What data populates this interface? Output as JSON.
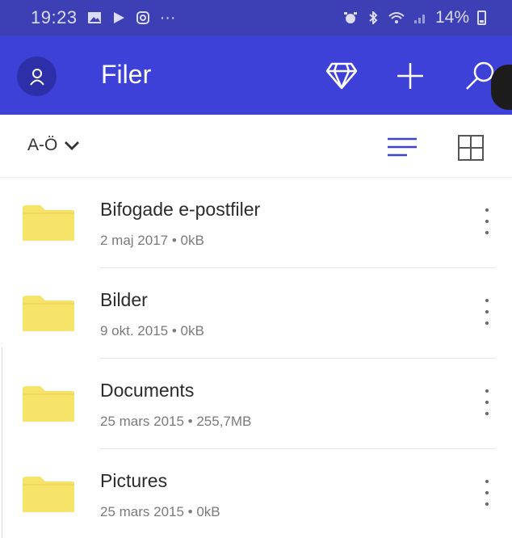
{
  "status_bar": {
    "time": "19:23",
    "battery": "14%",
    "dots": "···"
  },
  "app_bar": {
    "title": "Filer",
    "icons": [
      "avatar-icon",
      "diamond-icon",
      "plus-icon",
      "search-icon"
    ]
  },
  "toolbar": {
    "sort_label": "A-Ö",
    "icons": [
      "chevron-down-icon",
      "list-view-icon",
      "grid-view-icon"
    ]
  },
  "files": [
    {
      "name": "Bifogade e-postfiler",
      "meta": "2 maj 2017 • 0kB"
    },
    {
      "name": "Bilder",
      "meta": "9 okt. 2015 • 0kB"
    },
    {
      "name": "Documents",
      "meta": "25 mars 2015 • 255,7MB"
    },
    {
      "name": "Pictures",
      "meta": "25 mars 2015 • 0kB"
    }
  ],
  "colors": {
    "status_bar": "#3d3fb5",
    "app_bar": "#3e41d8",
    "folder": "#f6e36a",
    "accent": "#3e41d8"
  }
}
